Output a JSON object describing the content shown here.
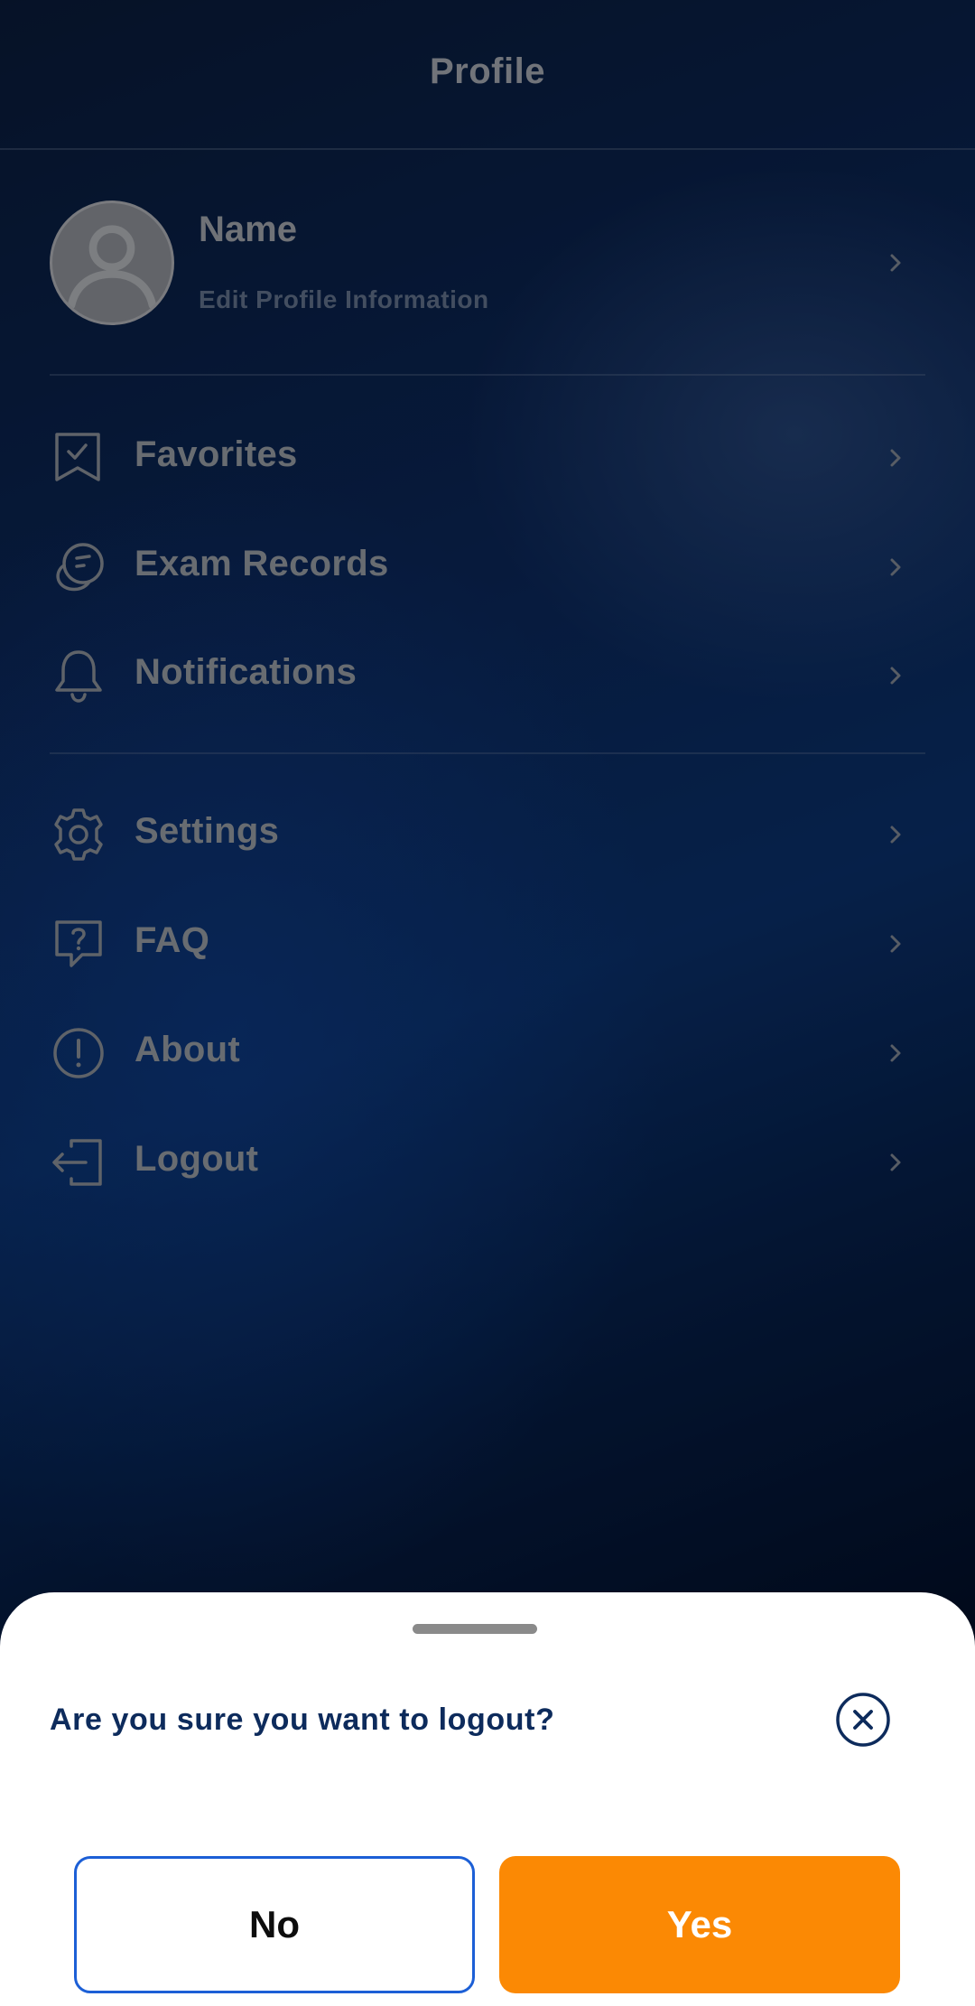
{
  "header": {
    "title": "Profile"
  },
  "profile": {
    "name": "Name",
    "subtitle": "Edit Profile Information"
  },
  "menu_groups": [
    [
      {
        "label": "Favorites",
        "icon": "bookmark-check-icon"
      },
      {
        "label": "Exam Records",
        "icon": "exam-records-icon"
      },
      {
        "label": "Notifications",
        "icon": "bell-icon"
      }
    ],
    [
      {
        "label": "Settings",
        "icon": "gear-icon"
      },
      {
        "label": "FAQ",
        "icon": "question-bubble-icon"
      },
      {
        "label": "About",
        "icon": "info-circle-icon"
      },
      {
        "label": "Logout",
        "icon": "logout-icon"
      }
    ]
  ],
  "dialog": {
    "title": "Are you sure you want to logout?",
    "no_label": "No",
    "yes_label": "Yes"
  },
  "colors": {
    "accent": "#fb8904",
    "primary_dark": "#0d2b5c",
    "outline_blue": "#1c5fd6"
  }
}
